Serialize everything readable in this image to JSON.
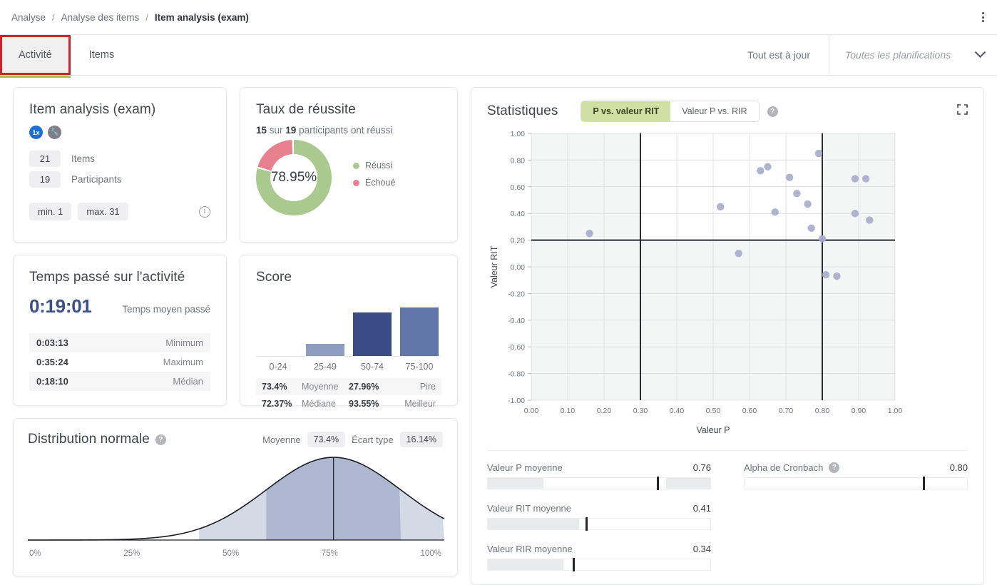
{
  "breadcrumb": {
    "items": [
      "Analyse",
      "Analyse des items",
      "Item analysis (exam)"
    ],
    "separator": "/",
    "menu_icon": "kebab-menu-icon"
  },
  "tabs": {
    "items": [
      {
        "label": "Activité",
        "selected": true
      },
      {
        "label": "Items",
        "selected": false
      }
    ],
    "updated_label": "Tout est à jour",
    "plan_select_placeholder": "Toutes les planifications",
    "plan_select_value": "Toutes les planifications"
  },
  "item_card": {
    "title": "Item analysis (exam)",
    "badge_1x": "1x",
    "badge_tool_icon": "wrench-icon",
    "items_count": "21",
    "items_label": "Items",
    "participants_count": "19",
    "participants_label": "Participants",
    "min_label": "min. 1",
    "max_label": "max. 31",
    "info_icon": "info-icon"
  },
  "success_card": {
    "title": "Taux de réussite",
    "subtitle_prefix": "15",
    "subtitle_mid": " sur ",
    "subtitle_count": "19",
    "subtitle_suffix": " participants ont réussi",
    "percent": "78.95%",
    "legend": [
      {
        "label": "Réussi",
        "color": "#a9c98f"
      },
      {
        "label": "Échoué",
        "color": "#e8808f"
      }
    ]
  },
  "time_card": {
    "title": "Temps passé sur l'activité",
    "average": "0:19:01",
    "average_label": "Temps moyen passé",
    "rows": [
      {
        "value": "0:03:13",
        "label": "Minimum"
      },
      {
        "value": "0:35:24",
        "label": "Maximum"
      },
      {
        "value": "0:18:10",
        "label": "Médian"
      }
    ]
  },
  "score_card": {
    "title": "Score",
    "table": [
      {
        "v1": "73.4%",
        "k1": "Moyenne",
        "v2": "27.96%",
        "k2": "Pire"
      },
      {
        "v1": "72.37%",
        "k1": "Médiane",
        "v2": "93.55%",
        "k2": "Meilleur"
      }
    ]
  },
  "distribution_card": {
    "title": "Distribution normale",
    "help_icon": "question-icon",
    "mean_label": "Moyenne",
    "mean_value": "73.4%",
    "sd_label": "Écart type",
    "sd_value": "16.14%"
  },
  "statistics_card": {
    "title": "Statistiques",
    "toggle": [
      {
        "label": "P vs. valeur RIT",
        "active": true
      },
      {
        "label": "Valeur P vs. RIR",
        "active": false
      }
    ],
    "help_icon": "question-icon",
    "expand_icon": "expand-icon",
    "metrics_left": [
      {
        "label": "Valeur P moyenne",
        "value": "0.76",
        "mark_pct": 76,
        "seg_start_pct": 0,
        "seg_start_w": 25,
        "seg_end_pct": 80,
        "seg_end_w": 20
      },
      {
        "label": "Valeur RIT moyenne",
        "value": "0.41",
        "mark_pct": 44,
        "seg_start_pct": 0,
        "seg_start_w": 41,
        "seg_end_pct": 100,
        "seg_end_w": 0
      },
      {
        "label": "Valeur RIR moyenne",
        "value": "0.34",
        "mark_pct": 38,
        "seg_start_pct": 0,
        "seg_start_w": 34,
        "seg_end_pct": 100,
        "seg_end_w": 0
      }
    ],
    "metrics_right": [
      {
        "label": "Alpha de Cronbach",
        "help_icon": "question-icon",
        "value": "0.80",
        "mark_pct": 80,
        "seg_start_pct": 0,
        "seg_start_w": 0,
        "seg_end_pct": 100,
        "seg_end_w": 0
      }
    ]
  },
  "chart_data": [
    {
      "type": "pie",
      "id": "success-donut",
      "title": "Taux de réussite",
      "labels": [
        "Réussi",
        "Échoué"
      ],
      "values": [
        78.95,
        21.05
      ],
      "colors": [
        "#a9c98f",
        "#e8808f"
      ],
      "center_label": "78.95%"
    },
    {
      "type": "bar",
      "id": "score-histogram",
      "title": "Score",
      "categories": [
        "0-24",
        "25-49",
        "50-74",
        "75-100"
      ],
      "values": [
        0,
        1,
        9,
        9
      ],
      "bar_colors": [
        "#8e9cc2",
        "#8e9cc2",
        "#3a4b85",
        "#6275a9"
      ],
      "bar_heights_pct": [
        0,
        20,
        72,
        80
      ],
      "xlabel": "",
      "ylabel": "",
      "ylim": [
        0,
        10
      ],
      "grid": false
    },
    {
      "type": "area",
      "id": "normal-distribution",
      "title": "Distribution normale",
      "mean": 73.4,
      "sd": 16.14,
      "xlabel": "",
      "ylabel": "",
      "xticks": [
        "0%",
        "25%",
        "50%",
        "75%",
        "100%"
      ],
      "xlim": [
        0,
        100
      ],
      "bands": [
        {
          "range_sd": 1,
          "color": "#a9b2cd"
        },
        {
          "range_sd": 2,
          "color": "#ccd2e2"
        }
      ],
      "grid": false
    },
    {
      "type": "scatter",
      "id": "p-vs-rit",
      "title": "Statistiques",
      "xlabel": "Valeur P",
      "ylabel": "Valeur RIT",
      "xlim": [
        0,
        1
      ],
      "ylim": [
        -1,
        1
      ],
      "xticks": [
        "0.00",
        "0.10",
        "0.20",
        "0.30",
        "0.40",
        "0.50",
        "0.60",
        "0.70",
        "0.80",
        "0.90",
        "1.00"
      ],
      "yticks": [
        "1.00",
        "0.80",
        "0.60",
        "0.40",
        "0.20",
        "0.00",
        "-0.20",
        "-0.40",
        "-0.60",
        "-0.80",
        "-1.00"
      ],
      "grid": true,
      "reference_lines": {
        "vertical": [
          0.3,
          0.8
        ],
        "horizontal": [
          0.2
        ]
      },
      "point_color": "#a7aecb",
      "points": [
        {
          "x": 0.16,
          "y": 0.25
        },
        {
          "x": 0.52,
          "y": 0.45
        },
        {
          "x": 0.57,
          "y": 0.1
        },
        {
          "x": 0.63,
          "y": 0.72
        },
        {
          "x": 0.65,
          "y": 0.75
        },
        {
          "x": 0.67,
          "y": 0.41
        },
        {
          "x": 0.71,
          "y": 0.67
        },
        {
          "x": 0.73,
          "y": 0.55
        },
        {
          "x": 0.76,
          "y": 0.47
        },
        {
          "x": 0.77,
          "y": 0.29
        },
        {
          "x": 0.79,
          "y": 0.85
        },
        {
          "x": 0.8,
          "y": 0.21
        },
        {
          "x": 0.81,
          "y": -0.06
        },
        {
          "x": 0.84,
          "y": -0.07
        },
        {
          "x": 0.89,
          "y": 0.66
        },
        {
          "x": 0.92,
          "y": 0.66
        },
        {
          "x": 0.89,
          "y": 0.4
        },
        {
          "x": 0.93,
          "y": 0.35
        }
      ]
    }
  ]
}
